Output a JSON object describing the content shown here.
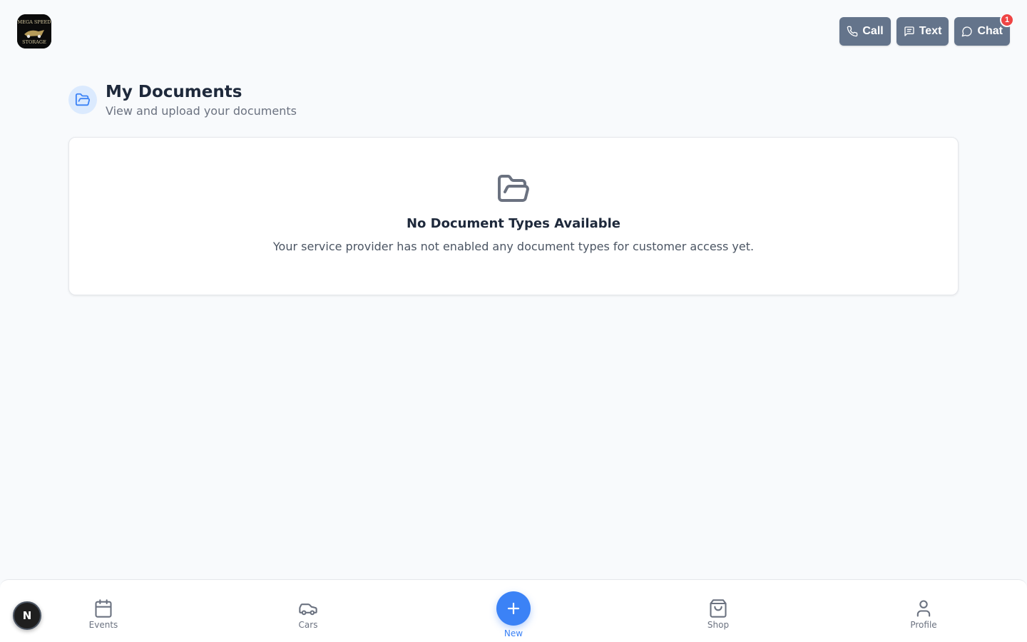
{
  "header": {
    "logo_text_top": "MEGA SPEED",
    "logo_text_bottom": "STORAGE",
    "call_label": "Call",
    "text_label": "Text",
    "chat_label": "Chat",
    "chat_badge": "1"
  },
  "page": {
    "title": "My Documents",
    "subtitle": "View and upload your documents"
  },
  "empty_state": {
    "title": "No Document Types Available",
    "message": "Your service provider has not enabled any document types for customer access yet."
  },
  "bottom_nav": {
    "avatar_initial": "N",
    "items": [
      {
        "label": "Events",
        "icon": "calendar-icon"
      },
      {
        "label": "Cars",
        "icon": "car-icon"
      },
      {
        "label": "New",
        "icon": "plus-icon"
      },
      {
        "label": "Shop",
        "icon": "shopping-bag-icon"
      },
      {
        "label": "Profile",
        "icon": "user-icon"
      }
    ]
  },
  "colors": {
    "background": "#f8fafc",
    "button_gray": "#64748b",
    "accent_blue": "#3b82f6",
    "badge_red": "#ef4444"
  }
}
